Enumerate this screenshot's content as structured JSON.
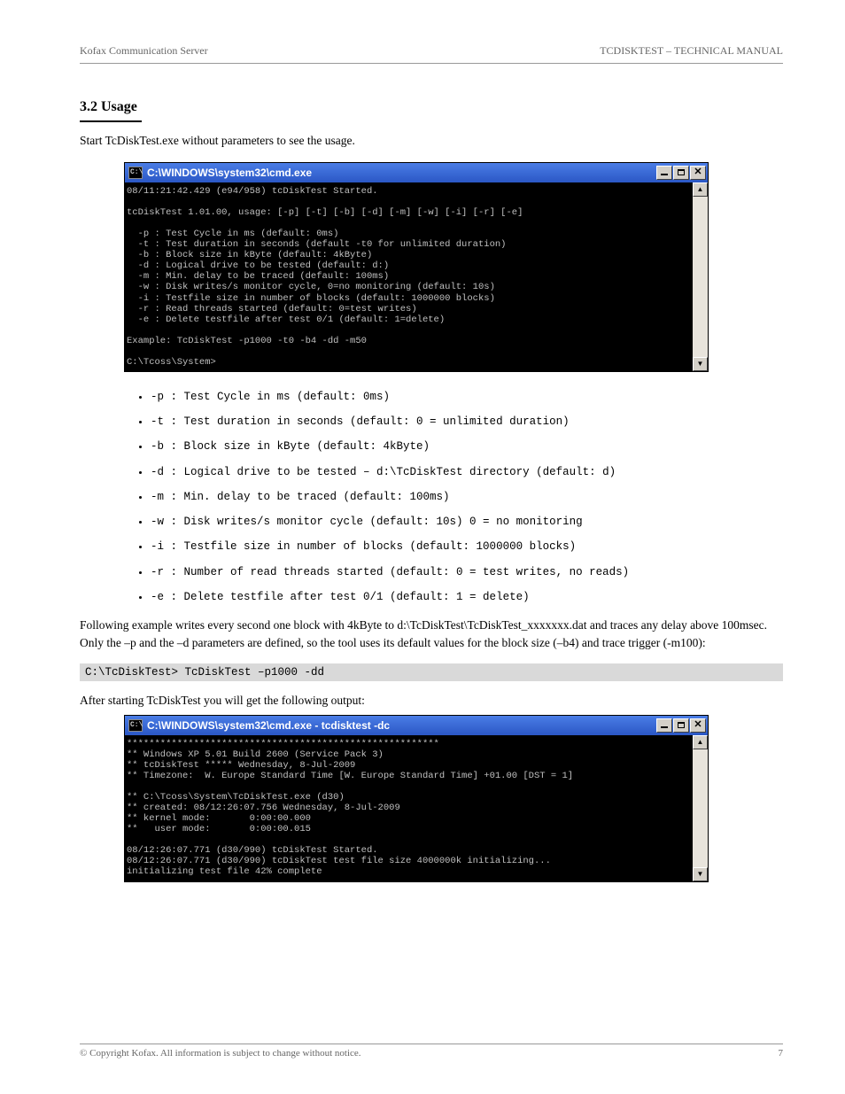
{
  "header": {
    "left": "Kofax Communication Server",
    "right": "TCDISKTEST – TECHNICAL MANUAL"
  },
  "footer": {
    "left": "© Copyright Kofax. All information is subject to change without notice.",
    "right": "7"
  },
  "section": {
    "title": "3.2 Usage",
    "intro": "Start TcDiskTest.exe without parameters to see the usage."
  },
  "cmd1": {
    "title": "C:\\WINDOWS\\system32\\cmd.exe",
    "icon": "C:\\",
    "body": "08/11:21:42.429 (e94/958) tcDiskTest Started.\n\ntcDiskTest 1.01.00, usage: [-p] [-t] [-b] [-d] [-m] [-w] [-i] [-r] [-e]\n\n  -p : Test Cycle in ms (default: 0ms)\n  -t : Test duration in seconds (default -t0 for unlimited duration)\n  -b : Block size in kByte (default: 4kByte)\n  -d : Logical drive to be tested (default: d:)\n  -m : Min. delay to be traced (default: 100ms)\n  -w : Disk writes/s monitor cycle, 0=no monitoring (default: 10s)\n  -i : Testfile size in number of blocks (default: 1000000 blocks)\n  -r : Read threads started (default: 0=test writes)\n  -e : Delete testfile after test 0/1 (default: 1=delete)\n\nExample: TcDiskTest -p1000 -t0 -b4 -dd -m50\n\nC:\\Tcoss\\System>"
  },
  "params": [
    "-p : Test Cycle in ms (default: 0ms)",
    "-t : Test duration in seconds (default: 0 = unlimited duration)",
    "-b : Block size in kByte (default: 4kByte)",
    "-d : Logical drive to be tested – d:\\TcDiskTest directory (default: d)",
    "-m : Min. delay to be traced (default: 100ms)",
    "-w : Disk writes/s monitor cycle (default: 10s) 0 = no monitoring",
    "-i : Testfile size in number of blocks (default: 1000000 blocks)",
    "-r : Number of read threads started (default: 0 = test writes, no reads)",
    "-e : Delete testfile after test 0/1 (default: 1 = delete)"
  ],
  "example_caption": "Following example writes every second one block with 4kByte to d:\\TcDiskTest\\TcDiskTest_xxxxxxx.dat and traces any delay above 100msec. Only the –p and the –d parameters are defined, so the tool uses its default values for the block size (–b4) and trace trigger (-m100):",
  "codebox": "C:\\TcDiskTest> TcDiskTest –p1000 -dd",
  "figcap": "After starting TcDiskTest you will get the following output:",
  "cmd2": {
    "title": "C:\\WINDOWS\\system32\\cmd.exe - tcdisktest -dc",
    "icon": "C:\\",
    "body": "********************************************************\n** Windows XP 5.01 Build 2600 (Service Pack 3)\n** tcDiskTest ***** Wednesday, 8-Jul-2009\n** Timezone:  W. Europe Standard Time [W. Europe Standard Time] +01.00 [DST = 1]\n\n** C:\\Tcoss\\System\\TcDiskTest.exe (d30)\n** created: 08/12:26:07.756 Wednesday, 8-Jul-2009\n** kernel mode:       0:00:00.000\n**   user mode:       0:00:00.015\n\n08/12:26:07.771 (d30/990) tcDiskTest Started.\n08/12:26:07.771 (d30/990) tcDiskTest test file size 4000000k initializing...\ninitializing test file 42% complete"
  }
}
